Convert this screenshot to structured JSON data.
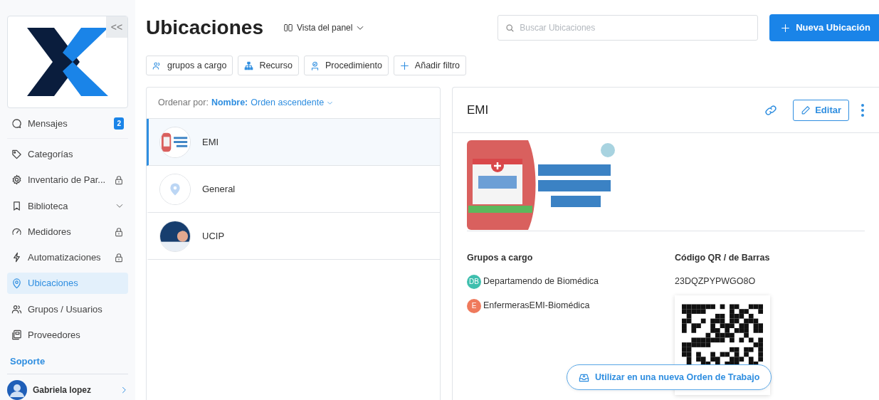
{
  "sidebar": {
    "collapse_label": "<<",
    "items": [
      {
        "label": "Mensajes",
        "badge": "2",
        "selected": false,
        "locked": false,
        "has_submenu": false
      },
      {
        "label": "Categorías",
        "selected": false,
        "locked": false,
        "has_submenu": false
      },
      {
        "label": "Inventario de Par...",
        "selected": false,
        "locked": true,
        "has_submenu": false
      },
      {
        "label": "Biblioteca",
        "selected": false,
        "locked": false,
        "has_submenu": true
      },
      {
        "label": "Medidores",
        "selected": false,
        "locked": true,
        "has_submenu": false
      },
      {
        "label": "Automatizaciones",
        "selected": false,
        "locked": true,
        "has_submenu": false
      },
      {
        "label": "Ubicaciones",
        "selected": true,
        "locked": false,
        "has_submenu": false
      },
      {
        "label": "Grupos / Usuarios",
        "selected": false,
        "locked": false,
        "has_submenu": false
      },
      {
        "label": "Proveedores",
        "selected": false,
        "locked": false,
        "has_submenu": false
      }
    ],
    "section": "Soporte",
    "user": {
      "name": "Gabriela lopez"
    }
  },
  "header": {
    "title": "Ubicaciones",
    "view": "Vista del panel",
    "search": {
      "placeholder": "Buscar Ubicaciones"
    },
    "new_button": "Nueva Ubicación"
  },
  "filters": [
    "grupos a cargo",
    "Recurso",
    "Procedimiento",
    "Añadir filtro"
  ],
  "list": {
    "sort_label": "Ordenar por:",
    "sort_field": "Nombre:",
    "sort_order": "Orden ascendente",
    "rows": [
      {
        "name": "EMI",
        "selected": true,
        "kind": "image"
      },
      {
        "name": "General",
        "selected": false,
        "kind": "pin"
      },
      {
        "name": "UCIP",
        "selected": false,
        "kind": "photo"
      }
    ]
  },
  "detail": {
    "title": "EMI",
    "edit_button": "Editar",
    "groups_heading": "Grupos a cargo",
    "groups": [
      {
        "initials": "DB",
        "name": "Departamendo de Biomédica",
        "color": "#3fbfae"
      },
      {
        "initials": "E",
        "name": "EnfermerasEMI-Biomédica",
        "color": "#ef7a5c"
      }
    ],
    "code_heading": "Código QR / de Barras",
    "code": "23DQZPYPWGO8O",
    "use_button": "Utilizar en una nueva Orden de Trabajo"
  }
}
